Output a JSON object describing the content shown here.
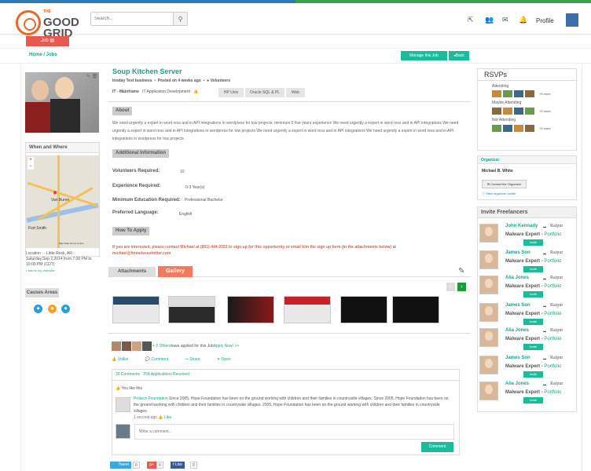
{
  "header": {
    "logo": {
      "the": "THE",
      "line1": "GOOD",
      "line2": "GRID"
    },
    "search_placeholder": "Search...",
    "profile_label": "Profile"
  },
  "jobbar": {
    "job_label": "Job"
  },
  "breadcrumb": {
    "text": "Home / Jobs",
    "manage_label": "Manage this Job",
    "back_label": "Back"
  },
  "job": {
    "title": "Soup Kitchen Server",
    "business": "Inoday Test business",
    "posted": "Posted on 4 weeks ago",
    "volunteers_label": "Volunteers",
    "category": "IT - Mainframe",
    "subcategory": "IT Application Development",
    "tags": [
      "HP Unix",
      "Oracle SQL & PL",
      "Web"
    ],
    "about_label": "About",
    "about_text": "We need urgently a expert in word ress and in API integrations in wordpress for tow projects. minimum 5 five years experience We need urgently a expert in word ress and in API integrations We need urgently a expert in word ress and in API integrations in wordpress for tow projects We need urgently a expert in word ress and in API integrations We need urgently a expert in word ress and in API integrations in wordpress for tow projects",
    "additional_label": "Additional Information",
    "info": [
      {
        "label": "Volunteers Required:",
        "value": "10"
      },
      {
        "label": "Experience Required:",
        "value": "0-3 Year(s)"
      },
      {
        "label": "Minimum Education Required:",
        "value": "Professional Bachelor"
      },
      {
        "label": "Preferred Language:",
        "value": "English"
      }
    ],
    "how_to_apply_label": "How To Apply",
    "apply_text": "If you are interested, please contact Michael at (901)-444-2323 to sign up for this opportunity or email him the sign up form (in the attachments below) at michael@homelessshelter.com"
  },
  "sidebar_left": {
    "when_where_label": "When and Where",
    "map": {
      "place1": "Van Buren",
      "place2": "Fort Smith",
      "footer": "Map Data   Terms of Use"
    },
    "location": "Location : - Little Rock, AR.",
    "datetime": "Saturday,Sep 2,2014 from 7:00 PM to 10:00 PM  (CDT)",
    "add_calendar": "Add to my calendar",
    "causes_label": "Causes Areas"
  },
  "gallery": {
    "attachments_tab": "Attachments",
    "gallery_tab": "Gallery",
    "prev": "‹",
    "next": "›"
  },
  "activity": {
    "applied_prefix": "+ 2 Others",
    "applied_middle": " have applied for this Job ",
    "apply_now": "Apply Now! >>",
    "unlike": "Unlike",
    "comment": "Comment",
    "share": "Share",
    "open": "Open",
    "comments_count": "26 Comments",
    "applications": "258 Applications Received",
    "you_like": "You like this",
    "commenter": "Protech Foundation",
    "comment_text": " Since 2005, Hope Foundation has been on the ground working with children and their families in countryside villages. Since 2005, Hope Foundation has been on the ground working with children and their families in countryside villages. 2005, Hope Foundation has been on the ground working with children and their families in countryside villages.",
    "comment_ago": "1 second ago",
    "comment_like": "Like",
    "write_placeholder": "Write a comment...",
    "comment_btn": "Comment"
  },
  "social": {
    "tweet": "Tweet",
    "tweet_count": "0",
    "gplus": "g+",
    "gplus_count": "0",
    "fb": "Like",
    "fb_count": "0"
  },
  "rsvps": {
    "title": "RSVPs",
    "groups": [
      {
        "label": "Attending",
        "more": "+5 more"
      },
      {
        "label": "Maybe Attending",
        "more": "+5 more"
      },
      {
        "label": "Not Attending",
        "more": "+5 more"
      }
    ]
  },
  "organizer": {
    "title": "Organizer",
    "name": "Michael B. White",
    "contact_btn": "Contact the Organizer",
    "view_profile": "View organizer profile"
  },
  "freelancers": {
    "title": "Invite Freelancers",
    "items": [
      {
        "name": "John Kennady",
        "city": "Raipur",
        "role": "Malware Expert",
        "link": "Portfolio",
        "invite": "Invite"
      },
      {
        "name": "James Son",
        "city": "Raipur",
        "role": "Malware Expert",
        "link": "Portfolio",
        "invite": "Invite"
      },
      {
        "name": "Alia Jones",
        "city": "Raipur",
        "role": "Malware Expert",
        "link": "Portfolio",
        "invite": "Invite"
      },
      {
        "name": "James Son",
        "city": "Raipur",
        "role": "Malware Expert",
        "link": "Portfolio",
        "invite": "Invite"
      },
      {
        "name": "Alia Jones",
        "city": "Raipur",
        "role": "Malware Expert",
        "link": "Portfolio",
        "invite": "Invite"
      },
      {
        "name": "James Son",
        "city": "Raipur",
        "role": "Malware Expert",
        "link": "Portfolio",
        "invite": "Invite"
      },
      {
        "name": "Alia Jones",
        "city": "Raipur",
        "role": "Malware Expert",
        "link": "Portfolio",
        "invite": "Invite"
      }
    ]
  },
  "colors": {
    "accent": "#1abc9c",
    "danger": "#e85a4f",
    "brand_orange": "#e8672a"
  }
}
